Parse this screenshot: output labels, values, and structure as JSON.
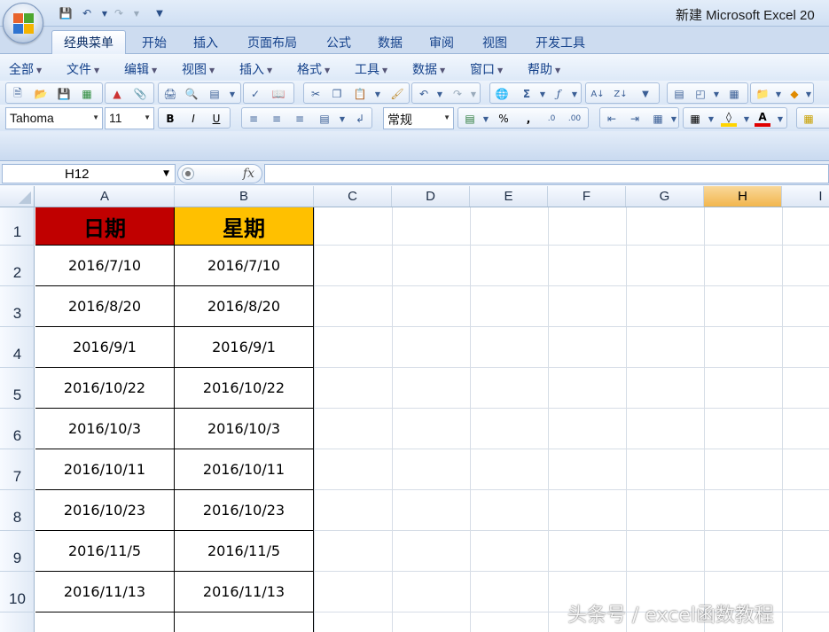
{
  "window": {
    "title": "新建 Microsoft Excel 20"
  },
  "ribbon": {
    "tabs": [
      {
        "label": "经典菜单",
        "active": true
      },
      {
        "label": "开始"
      },
      {
        "label": "插入"
      },
      {
        "label": "页面布局"
      },
      {
        "label": "公式"
      },
      {
        "label": "数据"
      },
      {
        "label": "审阅"
      },
      {
        "label": "视图"
      },
      {
        "label": "开发工具"
      }
    ],
    "menus": [
      "全部",
      "文件",
      "编辑",
      "视图",
      "插入",
      "格式",
      "工具",
      "数据",
      "窗口",
      "帮助"
    ],
    "font_name": "Tahoma",
    "font_size": "11",
    "number_format": "常规",
    "accent_colors": {
      "fill": "#ffd400",
      "font": "#e00000"
    }
  },
  "formula_bar": {
    "name_box": "H12",
    "fx_label": "fx",
    "formula": ""
  },
  "grid": {
    "columns": [
      "A",
      "B",
      "C",
      "D",
      "E",
      "F",
      "G",
      "H",
      "I"
    ],
    "selected_column": "H",
    "rows": [
      "1",
      "2",
      "3",
      "4",
      "5",
      "6",
      "7",
      "8",
      "9",
      "10"
    ],
    "header_row": {
      "A": {
        "text": "日期",
        "bg": "#c00000"
      },
      "B": {
        "text": "星期",
        "bg": "#ffc000"
      }
    },
    "data": [
      [
        "2016/7/10",
        "2016/7/10"
      ],
      [
        "2016/8/20",
        "2016/8/20"
      ],
      [
        "2016/9/1",
        "2016/9/1"
      ],
      [
        "2016/10/22",
        "2016/10/22"
      ],
      [
        "2016/10/3",
        "2016/10/3"
      ],
      [
        "2016/10/11",
        "2016/10/11"
      ],
      [
        "2016/10/23",
        "2016/10/23"
      ],
      [
        "2016/11/5",
        "2016/11/5"
      ],
      [
        "2016/11/13",
        "2016/11/13"
      ]
    ]
  },
  "watermark": "头条号 / excel函数教程"
}
